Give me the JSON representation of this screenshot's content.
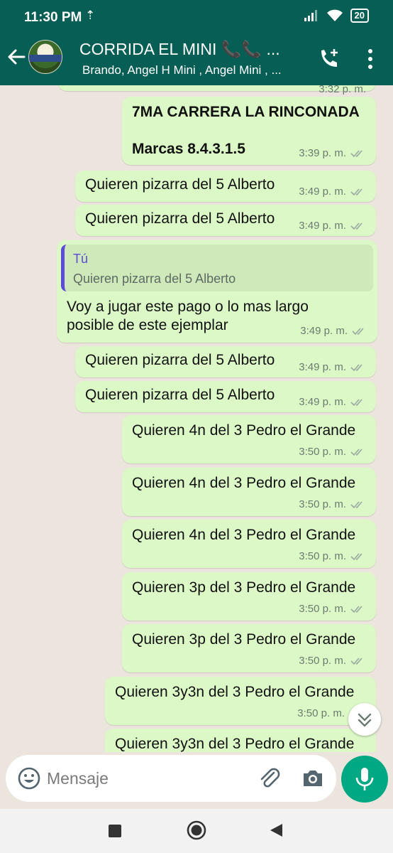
{
  "status": {
    "time": "11:30 PM",
    "battery": "20"
  },
  "header": {
    "title": "CORRIDA EL MINI 📞📞 ...",
    "subtitle": "Brando, Angel H Mini , Angel Mini , ..."
  },
  "messages": [
    {
      "time": "3:32 p. m."
    },
    {
      "line1": "7MA CARRERA LA RINCONADA",
      "line2": "Marcas 8.4.3.1.5",
      "time": "3:39 p. m."
    },
    {
      "text": "Quieren pizarra del 5 Alberto",
      "time": "3:49 p. m."
    },
    {
      "text": "Quieren pizarra del 5 Alberto",
      "time": "3:49 p. m."
    },
    {
      "quote_author": "Tú",
      "quote_text": "Quieren pizarra del 5 Alberto",
      "line1": "Voy a jugar este pago o lo mas largo",
      "line2": "posible de este ejemplar",
      "time": "3:49 p. m."
    },
    {
      "text": "Quieren pizarra del 5 Alberto",
      "time": "3:49 p. m."
    },
    {
      "text": "Quieren pizarra del 5 Alberto",
      "time": "3:49 p. m."
    },
    {
      "text": "Quieren 4n del 3 Pedro el Grande",
      "time": "3:50 p. m."
    },
    {
      "text": "Quieren 4n del 3 Pedro el Grande",
      "time": "3:50 p. m."
    },
    {
      "text": "Quieren 4n del 3 Pedro el Grande",
      "time": "3:50 p. m."
    },
    {
      "text": "Quieren 3p del 3 Pedro el Grande",
      "time": "3:50 p. m."
    },
    {
      "text": "Quieren 3p del 3 Pedro el Grande",
      "time": "3:50 p. m."
    },
    {
      "text": "Quieren 3y3n del 3 Pedro el Grande",
      "time": "3:50 p. m."
    },
    {
      "text": "Quieren 3y3n del 3 Pedro el Grande"
    }
  ],
  "composer": {
    "placeholder": "Mensaje"
  },
  "colors": {
    "header": "#075e54",
    "outgoing_bubble": "#dcf8c6",
    "read_ticks": "#4fa3d9",
    "mic": "#00a884"
  }
}
